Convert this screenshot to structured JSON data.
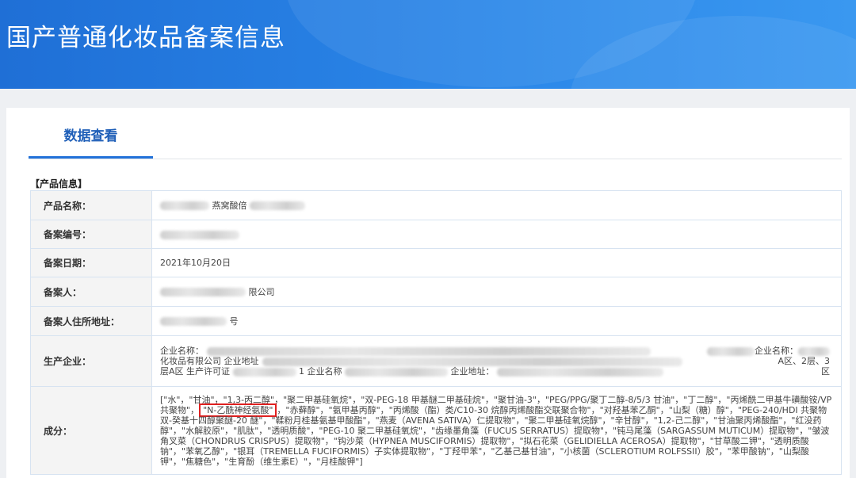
{
  "header": {
    "title": "国产普通化妆品备案信息"
  },
  "tabs": [
    {
      "label": "数据查看"
    }
  ],
  "section": {
    "title": "【产品信息】"
  },
  "fields": {
    "product_name": {
      "label": "产品名称：",
      "value": "燕窝酸倍"
    },
    "record_no": {
      "label": "备案编号：",
      "value": ""
    },
    "record_date": {
      "label": "备案日期：",
      "value": "2021年10月20日"
    },
    "registrant": {
      "label": "备案人：",
      "value": "限公司"
    },
    "registrant_address": {
      "label": "备案人住所地址：",
      "value": "号"
    },
    "producer": {
      "label": "生产企业：",
      "line1": "企业名称：",
      "line1_end": "企业名称：",
      "line2": "化妆品有限公司 企业地址",
      "line2_end": "A区、2层、3",
      "line3": "层A区 生产许可证",
      "line3_mid": "1 企业名称",
      "line3_mid2": "企业地址：",
      "line3_end": "区"
    },
    "ingredients": {
      "label": "成分：",
      "highlighted": "\"N-乙酰神经氨酸\"",
      "text_before": "[\"水\"，\"甘油\"，\"1,3-丙二醇\"，\"聚二甲基硅氧烷\"，\"双-PEG-18 甲基醚二甲基硅烷\"，\"聚甘油-3\"，\"PEG/PPG/聚丁二醇-8/5/3 甘油\"，\"丁二醇\"，\"丙烯酰二甲基牛磺酸铵/VP 共聚物\"，",
      "text_after": "，\"赤藓醇\"，\"氨甲基丙醇\"，\"丙烯酸（酯）类/C10-30 烷醇丙烯酸酯交联聚合物\"，\"对羟基苯乙酮\"，\"山梨（糖）醇\"，\"PEG-240/HDI 共聚物双-癸基十四醇聚醚-20 醚\"，\"鞣粉月桂基氨基甲酸酯\"，\"燕麦（AVENA SATIVA）仁提取物\"，\"聚二甲基硅氧烷醇\"，\"辛甘醇\"，\"1,2-己二醇\"，\"甘油聚丙烯酸酯\"，\"红没药醇\"，\"水解胶原\"，\"肌肽\"，\"透明质酸\"，\"PEG-10 聚二甲基硅氧烷\"，\"齿缘墨角藻（FUCUS SERRATUS）提取物\"，\"钝马尾藻（SARGASSUM MUTICUM）提取物\"，\"皱波角叉菜（CHONDRUS CRISPUS）提取物\"，\"钩沙菜（HYPNEA MUSCIFORMIS）提取物\"，\"拟石花菜（GELIDIELLA ACEROSA）提取物\"，\"甘草酸二钾\"，\"透明质酸钠\"，\"苯氧乙醇\"，\"银耳（TREMELLA FUCIFORMIS）子实体提取物\"，\"丁羟甲苯\"，\"乙基己基甘油\"，\"小核菌（SCLEROTIUM ROLFSSII）胶\"，\"苯甲酸钠\"，\"山梨酸钾\"，\"焦糖色\"，\"生育酚（维生素E）\"，\"月桂酸钾\"]"
    }
  }
}
